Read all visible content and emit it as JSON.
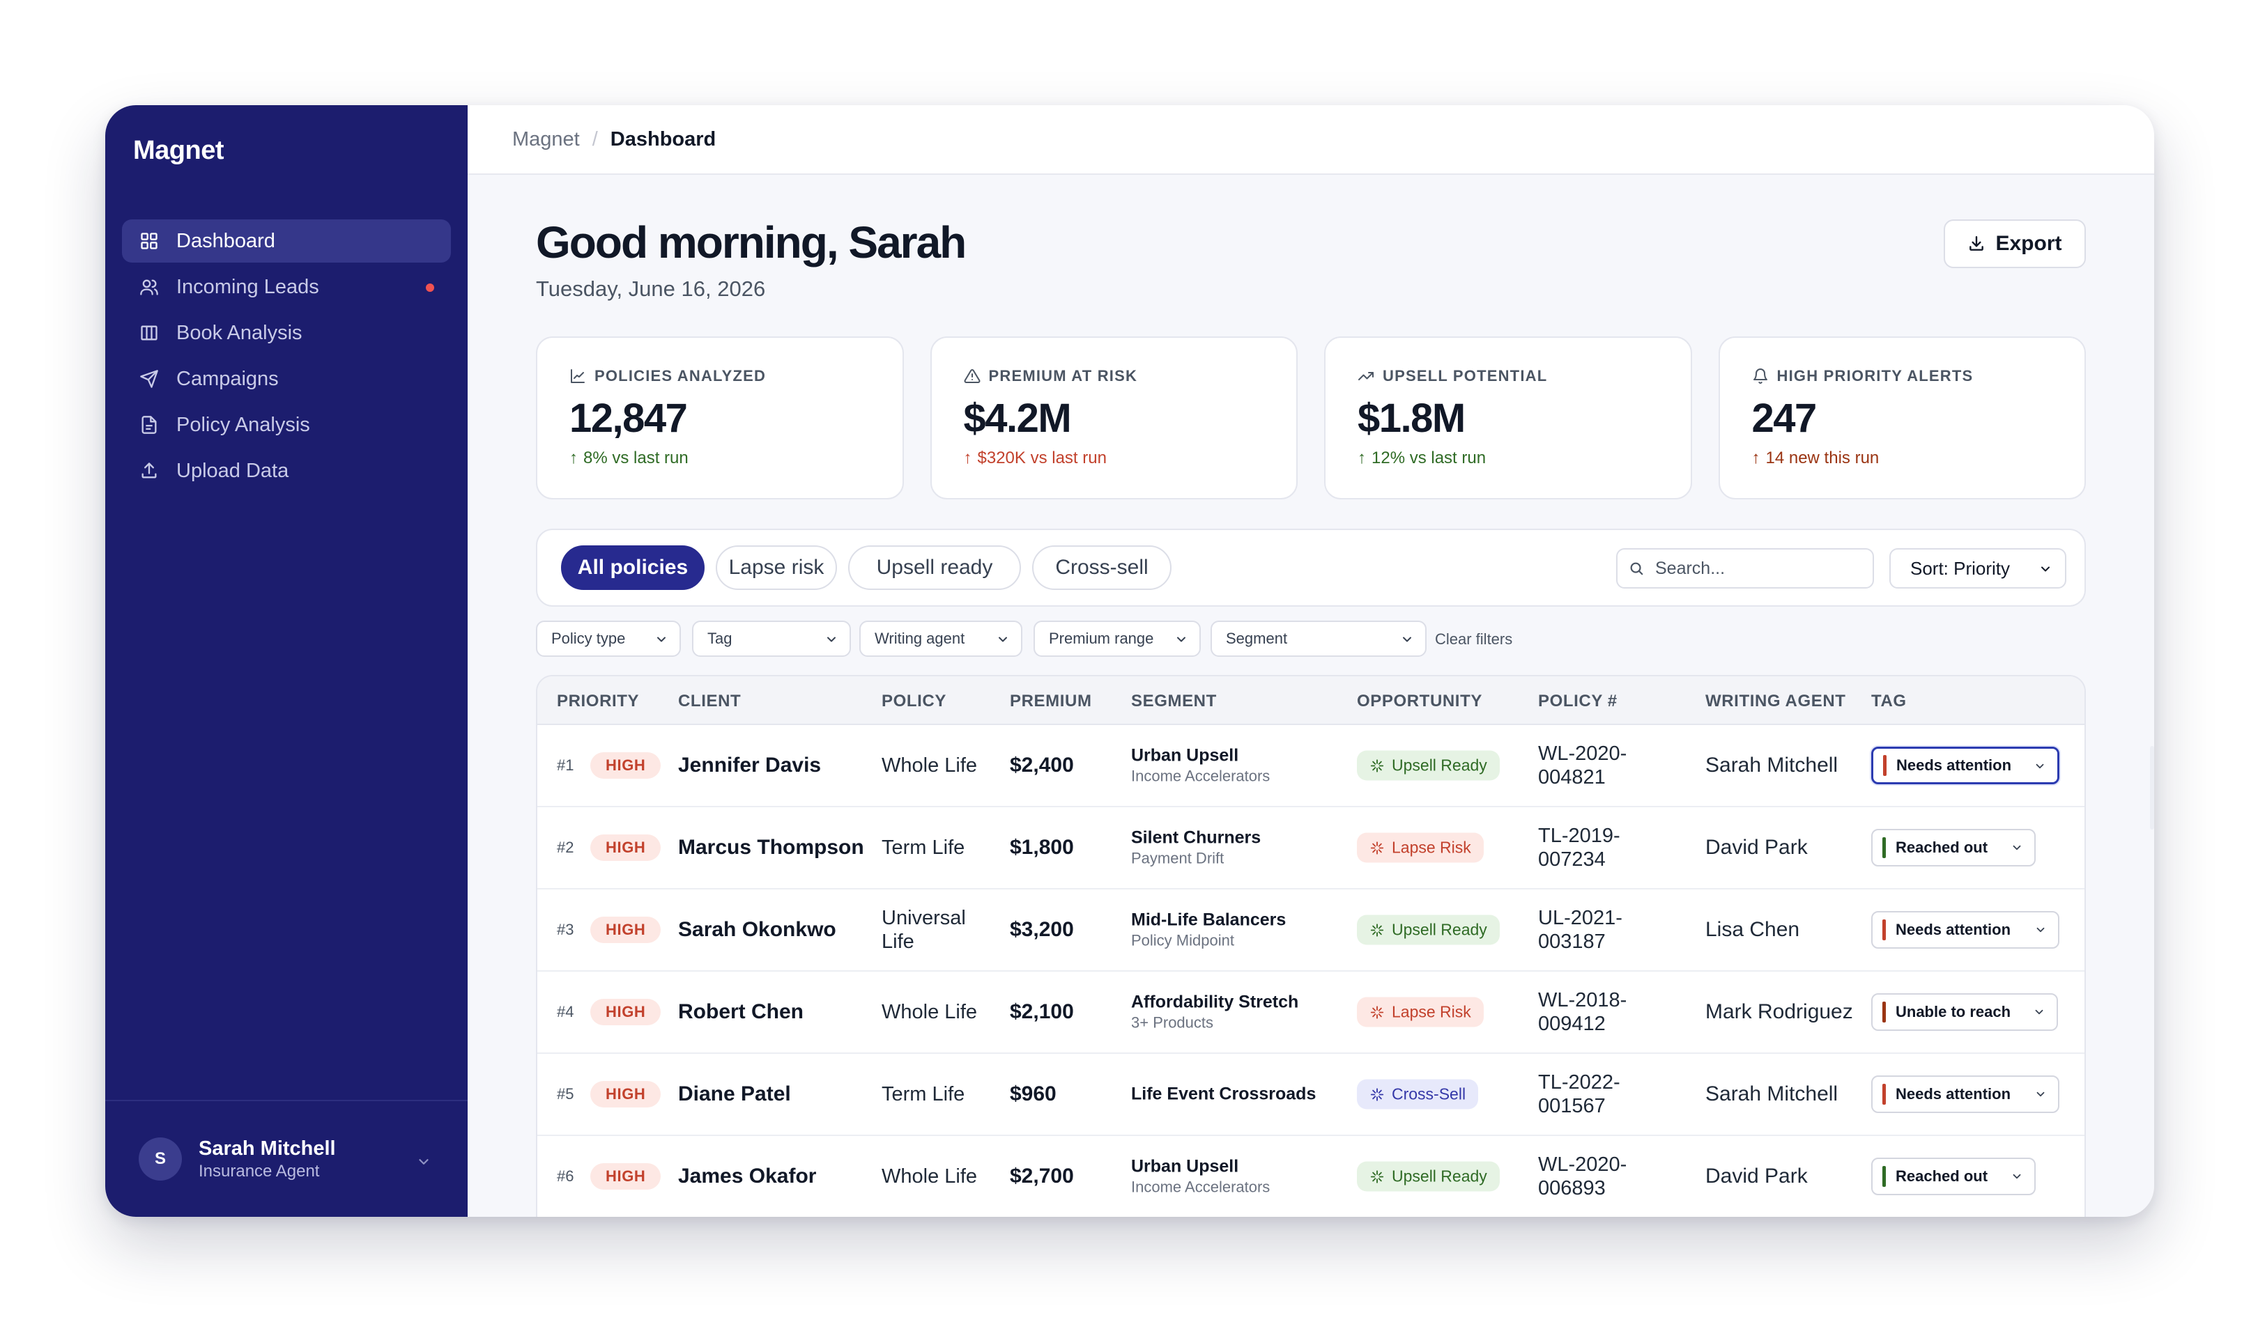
{
  "app": {
    "brand": "Magnet"
  },
  "sidebar": {
    "items": [
      {
        "label": "Dashboard",
        "icon": "grid-icon",
        "active": true,
        "badge": false
      },
      {
        "label": "Incoming Leads",
        "icon": "users-icon",
        "active": false,
        "badge": true
      },
      {
        "label": "Book Analysis",
        "icon": "columns-icon",
        "active": false,
        "badge": false
      },
      {
        "label": "Campaigns",
        "icon": "send-icon",
        "active": false,
        "badge": false
      },
      {
        "label": "Policy Analysis",
        "icon": "document-icon",
        "active": false,
        "badge": false
      },
      {
        "label": "Upload Data",
        "icon": "upload-icon",
        "active": false,
        "badge": false
      }
    ],
    "user": {
      "initial": "S",
      "name": "Sarah Mitchell",
      "role": "Insurance Agent"
    }
  },
  "breadcrumb": {
    "root": "Magnet",
    "separator": "/",
    "current": "Dashboard"
  },
  "header": {
    "greeting": "Good morning, Sarah",
    "date": "Tuesday, June 16, 2026",
    "export_label": "Export"
  },
  "stats": [
    {
      "label": "POLICIES ANALYZED",
      "icon": "chart-line-icon",
      "value": "12,847",
      "delta": "8% vs last run",
      "delta_color": "#2f6b25"
    },
    {
      "label": "PREMIUM AT RISK",
      "icon": "warning-triangle-icon",
      "value": "$4.2M",
      "delta": "$320K vs last run",
      "delta_color": "#c2412c"
    },
    {
      "label": "UPSELL POTENTIAL",
      "icon": "trending-up-icon",
      "value": "$1.8M",
      "delta": "12% vs last run",
      "delta_color": "#2f6b25"
    },
    {
      "label": "HIGH PRIORITY ALERTS",
      "icon": "bell-icon",
      "value": "247",
      "delta": "14 new this run",
      "delta_color": "#9a3412"
    }
  ],
  "tabs": [
    {
      "label": "All policies",
      "active": true
    },
    {
      "label": "Lapse risk",
      "active": false
    },
    {
      "label": "Upsell ready",
      "active": false
    },
    {
      "label": "Cross-sell",
      "active": false
    }
  ],
  "search": {
    "placeholder": "Search..."
  },
  "sort": {
    "value": "Sort: Priority"
  },
  "filters": [
    {
      "label": "Policy type"
    },
    {
      "label": "Tag"
    },
    {
      "label": "Writing agent"
    },
    {
      "label": "Premium range"
    },
    {
      "label": "Segment"
    }
  ],
  "clear_filters": "Clear filters",
  "table": {
    "columns": [
      "PRIORITY",
      "CLIENT",
      "POLICY",
      "PREMIUM",
      "SEGMENT",
      "OPPORTUNITY",
      "POLICY #",
      "WRITING AGENT",
      "TAG"
    ],
    "rows": [
      {
        "rank": "#1",
        "priority": "HIGH",
        "client": "Jennifer Davis",
        "policy": "Whole Life",
        "premium": "$2,400",
        "segment": "Urban Upsell",
        "segment_sub": "Income Accelerators",
        "opportunity": "Upsell Ready",
        "opp_kind": "upsell",
        "policy_num": "WL-2020-004821",
        "agent": "Sarah Mitchell",
        "tag": "Needs attention",
        "tag_color": "#c2412c"
      },
      {
        "rank": "#2",
        "priority": "HIGH",
        "client": "Marcus Thompson",
        "policy": "Term Life",
        "premium": "$1,800",
        "segment": "Silent Churners",
        "segment_sub": "Payment Drift",
        "opportunity": "Lapse Risk",
        "opp_kind": "lapse",
        "policy_num": "TL-2019-007234",
        "agent": "David Park",
        "tag": "Reached out",
        "tag_color": "#2f6b25"
      },
      {
        "rank": "#3",
        "priority": "HIGH",
        "client": "Sarah Okonkwo",
        "policy": "Universal Life",
        "premium": "$3,200",
        "segment": "Mid-Life Balancers",
        "segment_sub": "Policy Midpoint",
        "opportunity": "Upsell Ready",
        "opp_kind": "upsell",
        "policy_num": "UL-2021-003187",
        "agent": "Lisa Chen",
        "tag": "Needs attention",
        "tag_color": "#c2412c"
      },
      {
        "rank": "#4",
        "priority": "HIGH",
        "client": "Robert Chen",
        "policy": "Whole Life",
        "premium": "$2,100",
        "segment": "Affordability Stretch",
        "segment_sub": "3+ Products",
        "opportunity": "Lapse Risk",
        "opp_kind": "lapse",
        "policy_num": "WL-2018-009412",
        "agent": "Mark Rodriguez",
        "tag": "Unable to reach",
        "tag_color": "#9a3412"
      },
      {
        "rank": "#5",
        "priority": "HIGH",
        "client": "Diane Patel",
        "policy": "Term Life",
        "premium": "$960",
        "segment": "Life Event Crossroads",
        "segment_sub": "",
        "opportunity": "Cross-Sell",
        "opp_kind": "cross",
        "policy_num": "TL-2022-001567",
        "agent": "Sarah Mitchell",
        "tag": "Needs attention",
        "tag_color": "#c2412c"
      },
      {
        "rank": "#6",
        "priority": "HIGH",
        "client": "James Okafor",
        "policy": "Whole Life",
        "premium": "$2,700",
        "segment": "Urban Upsell",
        "segment_sub": "Income Accelerators",
        "opportunity": "Upsell Ready",
        "opp_kind": "upsell",
        "policy_num": "WL-2020-006893",
        "agent": "David Park",
        "tag": "Reached out",
        "tag_color": "#2f6b25"
      }
    ]
  }
}
